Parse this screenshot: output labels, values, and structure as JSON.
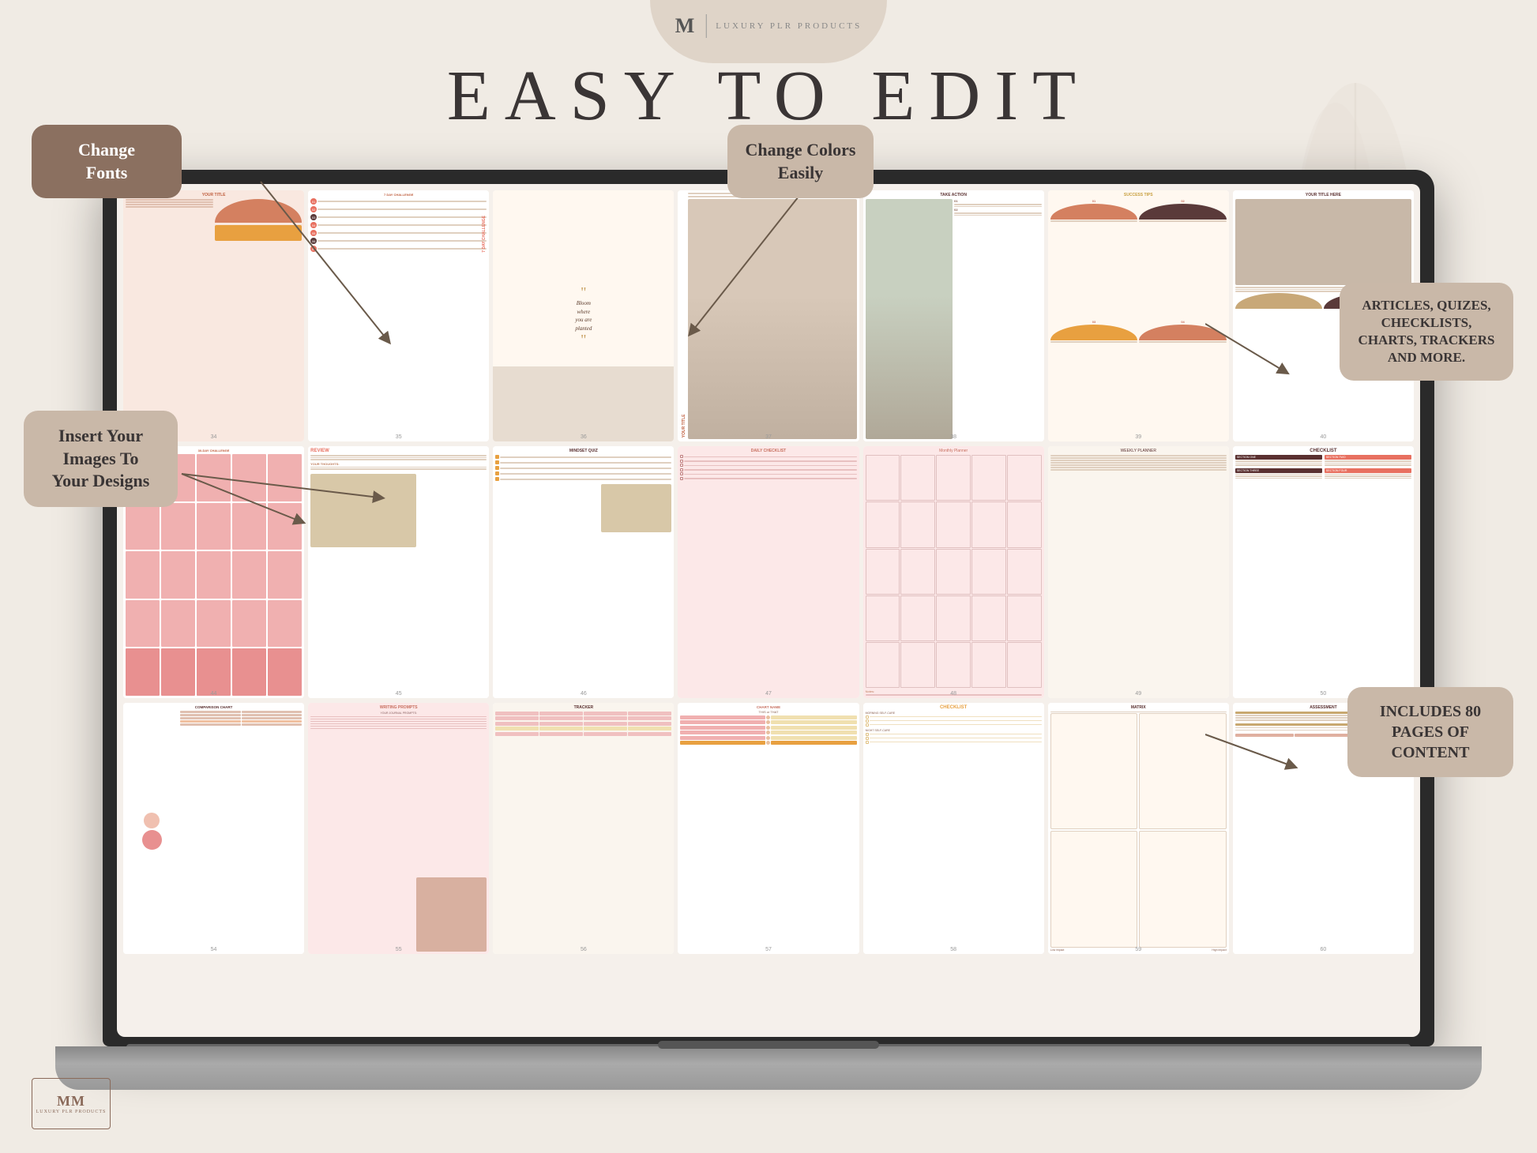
{
  "header": {
    "brand": "M",
    "divider": "|",
    "tagline": "LUXURY PLR PRODUCTS"
  },
  "main_title": "EASY TO EDIT",
  "callouts": {
    "fonts": {
      "label": "Change\nFonts"
    },
    "colors": {
      "label": "Change Colors\nEasily"
    },
    "images": {
      "label": "Insert Your\nImages To\nYour Designs"
    },
    "articles": {
      "label": "ARTICLES, QUIZES,\nCHECKLISTS,\nCHARTS, TRACKERS\nAND MORE."
    },
    "includes": {
      "label": "INCLUDES 80\nPAGES OF\nCONTENT"
    }
  },
  "pages": {
    "row1": [
      {
        "num": "34",
        "title": "YOUR TITLE",
        "type": "arch-list"
      },
      {
        "num": "35",
        "title": "7 DAY CHALLENGE",
        "type": "numbered-list"
      },
      {
        "num": "36",
        "title": "Bloom where\nyou are\nplanted",
        "type": "quote"
      },
      {
        "num": "37",
        "title": "YOUR TITLE",
        "type": "vertical-title"
      },
      {
        "num": "38",
        "title": "TAKE ACTION",
        "type": "photo-content"
      },
      {
        "num": "39",
        "title": "SUCCESS TIPS",
        "type": "arch-grid"
      },
      {
        "num": "40",
        "title": "YOUR TITLE HERE",
        "type": "photo-top"
      }
    ],
    "row2": [
      {
        "num": "44",
        "title": "30-DAY CHALLENGE",
        "type": "pink-grid"
      },
      {
        "num": "45",
        "title": "REVIEW",
        "type": "review"
      },
      {
        "num": "46",
        "title": "MINDSET QUIZ",
        "type": "quiz"
      },
      {
        "num": "47",
        "title": "DAILY CHECKLIST",
        "type": "checklist-pink"
      },
      {
        "num": "48",
        "title": "Monthly Planner",
        "type": "planner"
      },
      {
        "num": "49",
        "title": "WEEKLY PLANNER",
        "type": "weekly-planner"
      },
      {
        "num": "50",
        "title": "CHECKLIST",
        "type": "two-col-checklist"
      }
    ],
    "row3": [
      {
        "num": "54",
        "title": "COMPARISON CHART",
        "type": "comparison"
      },
      {
        "num": "55",
        "title": "WRITING PROMPTS",
        "type": "writing"
      },
      {
        "num": "56",
        "title": "TRACKER",
        "type": "tracker"
      },
      {
        "num": "57",
        "title": "CHART NAME\nTHIS or THAT",
        "type": "this-that"
      },
      {
        "num": "58",
        "title": "CHECKLIST",
        "type": "checklist-orange"
      },
      {
        "num": "59",
        "title": "MATRIX",
        "type": "matrix"
      },
      {
        "num": "60",
        "title": "ASSESSMENT",
        "type": "assessment"
      }
    ]
  },
  "bottom_logo": {
    "text": "MM",
    "tagline": "LUXURY PLR PRODUCTS"
  }
}
